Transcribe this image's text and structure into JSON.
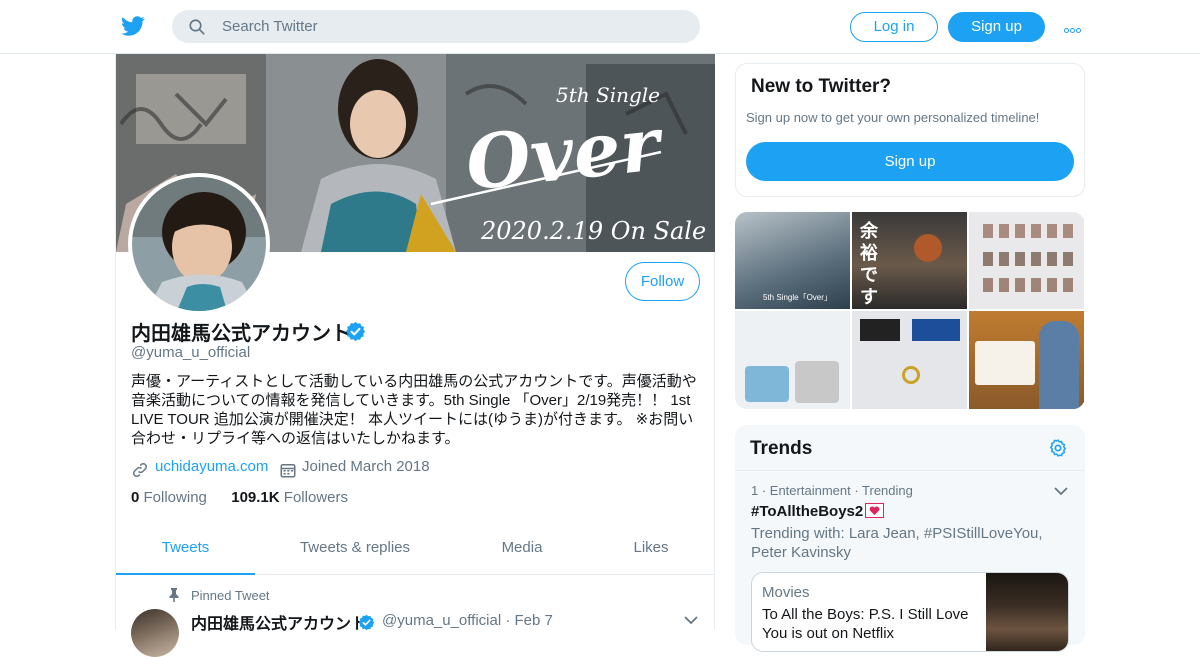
{
  "header": {
    "logo_icon": "twitter-bird-icon",
    "search_placeholder": "Search Twitter",
    "login_label": "Log in",
    "signup_label": "Sign up",
    "more_icon": "more-dots-icon",
    "brand_color": "#1da1f2"
  },
  "banner": {
    "title_script": "Over",
    "tag": "5th Single",
    "date_text": "2020.2.19 On Sale"
  },
  "profile": {
    "follow_label": "Follow",
    "name": "内田雄馬公式アカウント",
    "verified_icon": "verified-badge-icon",
    "handle": "@yuma_u_official",
    "bio": "声優・アーティストとして活動している内田雄馬の公式アカウントです。声優活動や音楽活動についての情報を発信していきます。5th Single 「Over」2/19発売！！ 1st LIVE TOUR 追加公演が開催決定！ 本人ツイートには(ゆうま)が付きます。 ※お問い合わせ・リプライ等への返信はいたしかねます。",
    "url": "uchidayuma.com",
    "joined": "Joined March 2018",
    "following_count": "0",
    "following_label": "Following",
    "followers_count": "109.1K",
    "followers_label": "Followers"
  },
  "tabs": [
    {
      "label": "Tweets",
      "active": true
    },
    {
      "label": "Tweets & replies",
      "active": false
    },
    {
      "label": "Media",
      "active": false
    },
    {
      "label": "Likes",
      "active": false
    }
  ],
  "pinned_tweet": {
    "label": "Pinned Tweet",
    "name": "内田雄馬公式アカウント",
    "handle_date": "@yuma_u_official · Feb 7"
  },
  "new_to_twitter": {
    "heading": "New to Twitter?",
    "subtitle": "Sign up now to get your own personalized timeline!",
    "signup_label": "Sign up"
  },
  "media_grid": {
    "overlay_text_1": "余裕です",
    "caption_1": "5th Single「Over」"
  },
  "trends": {
    "heading": "Trends",
    "settings_icon": "gear-icon",
    "item_meta": "1 · Entertainment · Trending",
    "item_tag": "#ToAlltheBoys2",
    "item_with": "Trending with: Lara Jean, #PSIStillLoveYou, Peter Kavinsky",
    "card_category": "Movies",
    "card_title": "To All the Boys: P.S. I Still Love You is out on Netflix"
  }
}
